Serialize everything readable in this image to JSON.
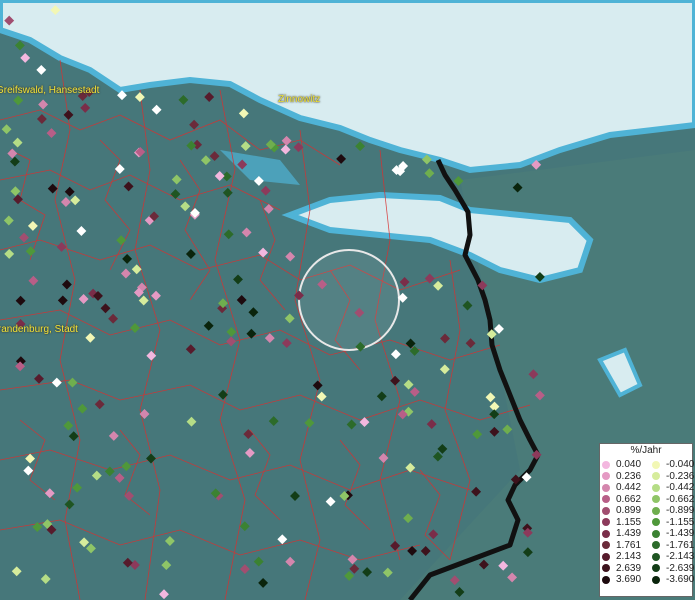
{
  "map": {
    "city_labels": [
      {
        "name": "Greifswald, Hansestadt"
      },
      {
        "name": "Zinnowitz"
      },
      {
        "name": "Neubrandenburg, Stadt"
      }
    ],
    "colors": {
      "land": "#46777a",
      "sea": "#d8ecf0",
      "coast_water": "#4fb3d6",
      "border": "#d93030",
      "national_border": "#1a1a1a",
      "highlight_circle": "#e8e8e8"
    }
  },
  "legend": {
    "title": "%/Jahr",
    "positive": [
      {
        "value": "0.040",
        "color": "#f3b7df"
      },
      {
        "value": "0.236",
        "color": "#e59ac4"
      },
      {
        "value": "0.442",
        "color": "#d486ad"
      },
      {
        "value": "0.662",
        "color": "#b85e87"
      },
      {
        "value": "0.899",
        "color": "#a14e70"
      },
      {
        "value": "1.155",
        "color": "#8c3a5b"
      },
      {
        "value": "1.439",
        "color": "#7a2d49"
      },
      {
        "value": "1.761",
        "color": "#6b2a3a"
      },
      {
        "value": "2.143",
        "color": "#571b2c"
      },
      {
        "value": "2.639",
        "color": "#3d121c"
      },
      {
        "value": "3.690",
        "color": "#1e0a0e"
      }
    ],
    "negative": [
      {
        "value": "-0.040",
        "color": "#f2f7b5"
      },
      {
        "value": "-0.236",
        "color": "#d6ec9c"
      },
      {
        "value": "-0.442",
        "color": "#b5dd86"
      },
      {
        "value": "-0.662",
        "color": "#8fc567"
      },
      {
        "value": "-0.899",
        "color": "#6fae4e"
      },
      {
        "value": "-1.155",
        "color": "#4f983a"
      },
      {
        "value": "-1.439",
        "color": "#3b8232"
      },
      {
        "value": "-1.761",
        "color": "#2c6b2a"
      },
      {
        "value": "-2.143",
        "color": "#1f5522"
      },
      {
        "value": "-2.639",
        "color": "#133d17"
      },
      {
        "value": "-3.690",
        "color": "#0a240c"
      }
    ]
  }
}
